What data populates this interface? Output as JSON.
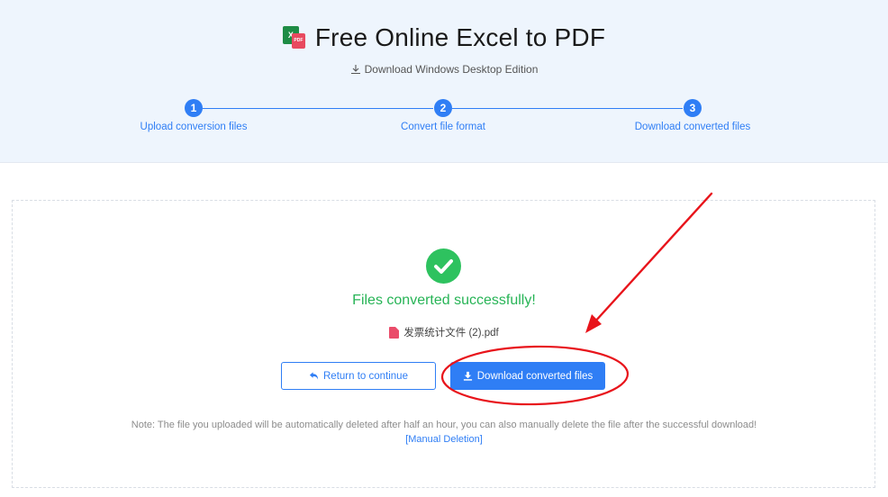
{
  "header": {
    "title": "Free Online Excel to PDF",
    "desktop_link": "Download Windows Desktop Edition",
    "logo_letter": "X",
    "logo_badge": "PDF"
  },
  "steps": [
    {
      "num": "1",
      "label": "Upload conversion files"
    },
    {
      "num": "2",
      "label": "Convert file format"
    },
    {
      "num": "3",
      "label": "Download converted files"
    }
  ],
  "result": {
    "message": "Files converted successfully!",
    "file_name": "发票统计文件 (2).pdf"
  },
  "buttons": {
    "return_label": "Return to continue",
    "download_label": "Download converted files"
  },
  "note": {
    "text": "Note: The file you uploaded will be automatically deleted after half an hour, you can also manually delete the file after the successful download!",
    "manual_link": "[Manual Deletion]"
  },
  "colors": {
    "accent": "#2f7ef5",
    "success": "#27b456",
    "header_bg": "#eef5fd",
    "annotation": "#e8141b"
  },
  "icons": {
    "logo": "excel-to-pdf-logo-icon",
    "desktop": "download-arrow-icon",
    "check": "checkmark-circle-icon",
    "file": "pdf-file-icon",
    "return": "return-arrow-icon",
    "download": "download-icon"
  }
}
